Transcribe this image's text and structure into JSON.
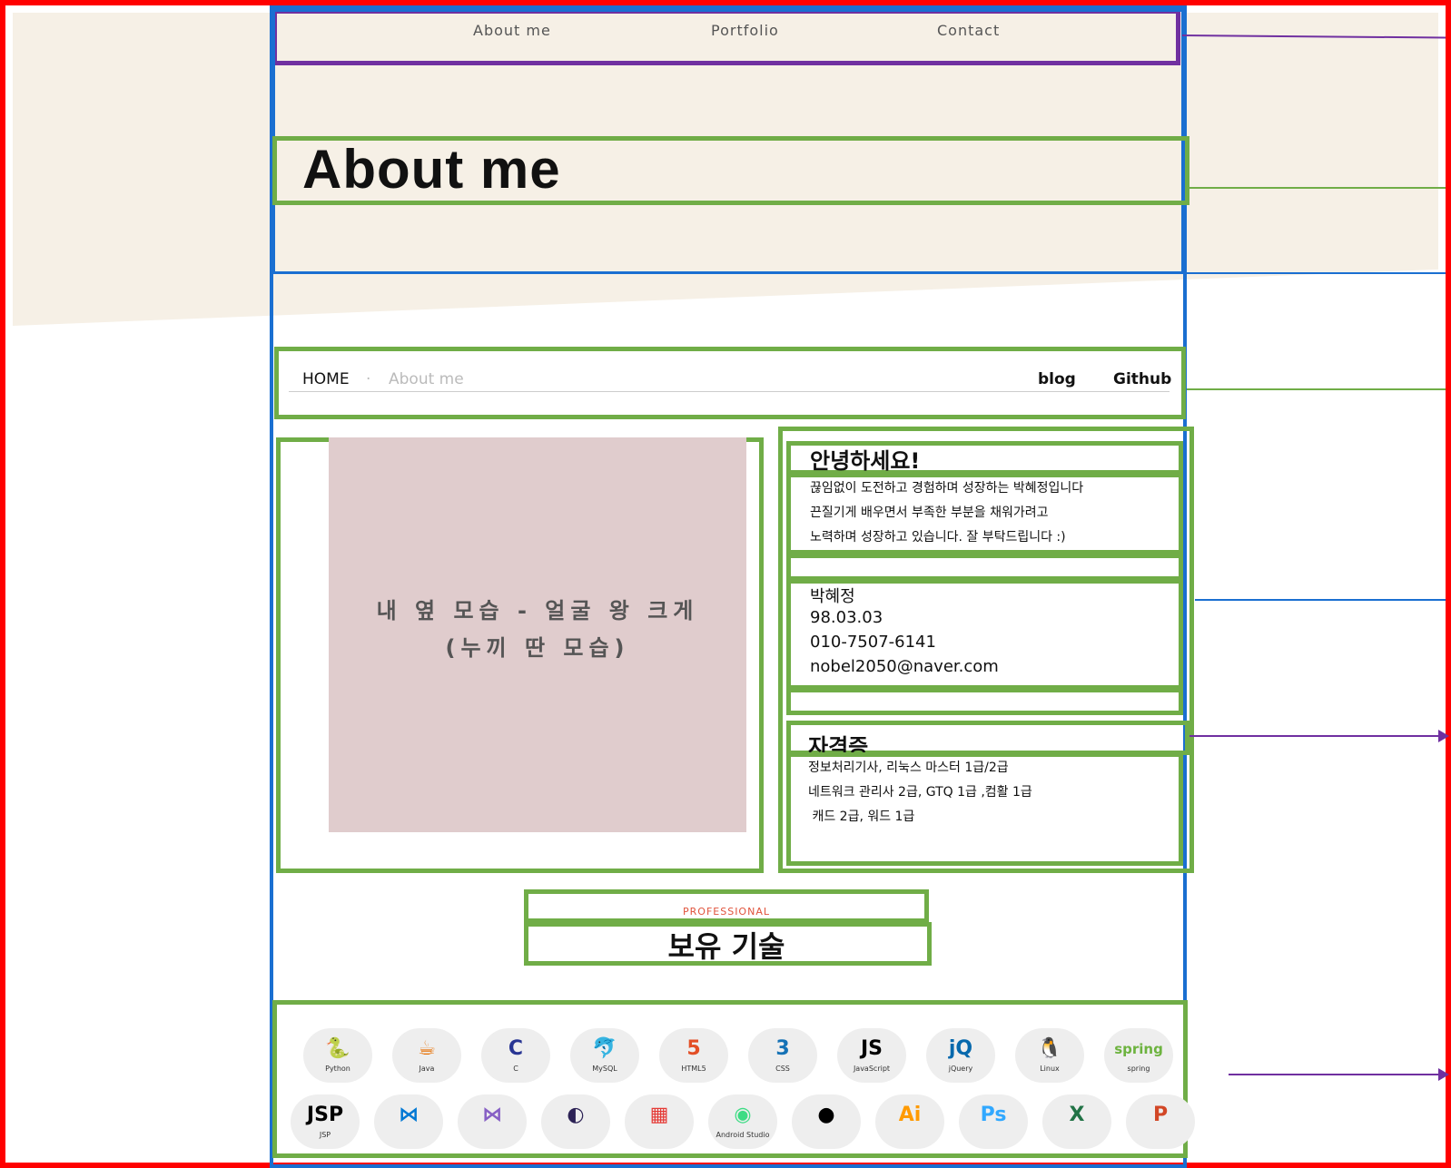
{
  "nav": {
    "links": [
      "About  me",
      "Portfolio",
      "Contact"
    ]
  },
  "hero": {
    "title": "About me"
  },
  "breadcrumb": {
    "home": "HOME",
    "separator": "·",
    "current": "About  me",
    "links": [
      "blog",
      "Github"
    ]
  },
  "photo": {
    "line1": "내 옆 모습 - 얼굴 왕 크게",
    "line2": "(누끼 딴 모습)"
  },
  "intro": {
    "heading": "안녕하세요!",
    "lines": [
      "끊임없이 도전하고 경험하며 성장하는 박혜정입니다",
      "끈질기게 배우면서 부족한 부분을 채워가려고",
      "노력하며 성장하고 있습니다. 잘 부탁드립니다 :)"
    ]
  },
  "profile": {
    "name": "박혜정",
    "birth": "98.03.03",
    "phone": "010-7507-6141",
    "email": "nobel2050@naver.com"
  },
  "certs": {
    "heading": "자격증",
    "lines": [
      "정보처리기사, 리눅스 마스터 1급/2급",
      "네트워크 관리사 2급, GTQ 1급 ,컴활 1급",
      " 캐드 2급, 워드 1급"
    ]
  },
  "skills_section": {
    "eyebrow": "PROFESSIONAL",
    "title": "보유 기술"
  },
  "skills_row1": [
    {
      "label": "Python",
      "icon": "python-icon",
      "glyph": "🐍",
      "color": "#3776ab"
    },
    {
      "label": "Java",
      "icon": "java-icon",
      "glyph": "☕",
      "color": "#e76f00"
    },
    {
      "label": "C",
      "icon": "c-icon",
      "glyph": "C",
      "color": "#283593"
    },
    {
      "label": "MySQL",
      "icon": "mysql-icon",
      "glyph": "🐬",
      "color": "#4479a1"
    },
    {
      "label": "HTML5",
      "icon": "html5-icon",
      "glyph": "5",
      "color": "#e34f26"
    },
    {
      "label": "CSS",
      "icon": "css-icon",
      "glyph": "3",
      "color": "#1572b6"
    },
    {
      "label": "JavaScript",
      "icon": "javascript-icon",
      "glyph": "JS",
      "color": "#000000"
    },
    {
      "label": "jQuery",
      "icon": "jquery-icon",
      "glyph": "jQ",
      "color": "#0769ad"
    },
    {
      "label": "Linux",
      "icon": "linux-icon",
      "glyph": "🐧",
      "color": "#000000"
    },
    {
      "label": "spring",
      "icon": "spring-icon",
      "glyph": "spring",
      "color": "#6db33f"
    }
  ],
  "skills_row2": [
    {
      "label": "JSP",
      "icon": "jsp-icon",
      "glyph": "JSP",
      "color": "#000000"
    },
    {
      "label": "",
      "icon": "vscode-icon",
      "glyph": "⋈",
      "color": "#0078d4"
    },
    {
      "label": "",
      "icon": "visual-studio-icon",
      "glyph": "⋈",
      "color": "#865fc5"
    },
    {
      "label": "",
      "icon": "eclipse-icon",
      "glyph": "◐",
      "color": "#2c2255"
    },
    {
      "label": "",
      "icon": "windows-icon",
      "glyph": "▦",
      "color": "#e53935"
    },
    {
      "label": "Android Studio",
      "icon": "android-studio-icon",
      "glyph": "◉",
      "color": "#3ddc84"
    },
    {
      "label": "",
      "icon": "github-icon",
      "glyph": "●",
      "color": "#000000"
    },
    {
      "label": "",
      "icon": "illustrator-icon",
      "glyph": "Ai",
      "color": "#ff9a00"
    },
    {
      "label": "",
      "icon": "photoshop-icon",
      "glyph": "Ps",
      "color": "#31a8ff"
    },
    {
      "label": "",
      "icon": "excel-icon",
      "glyph": "X",
      "color": "#217346"
    },
    {
      "label": "",
      "icon": "powerpoint-icon",
      "glyph": "P",
      "color": "#d24726"
    }
  ],
  "colors": {
    "red": "#ff0000",
    "blue": "#1a6fd1",
    "green": "#70ad47",
    "purple": "#7030a0",
    "beige": "#f6f0e6",
    "photo": "#e0cccd"
  }
}
